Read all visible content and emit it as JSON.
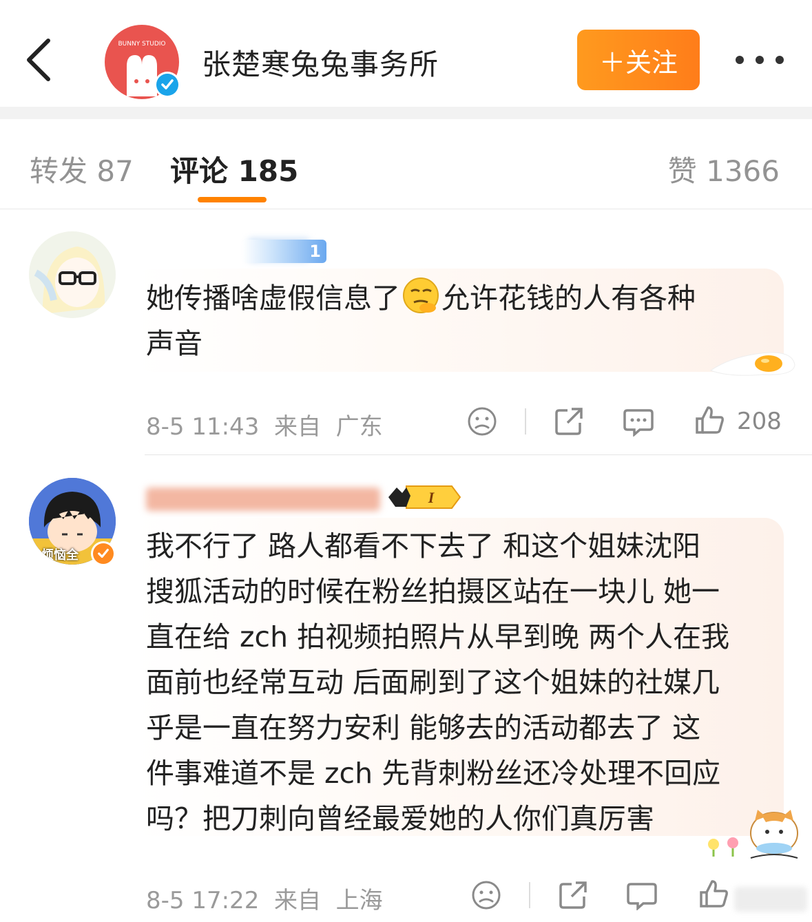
{
  "header": {
    "page_title": "张楚寒兔兔事务所",
    "avatar_text": "BUNNY STUDIO",
    "follow_label": "＋关注",
    "verified": true
  },
  "tabs": {
    "repost": "转发 87",
    "comment": "评论 185",
    "like": "赞 1366"
  },
  "comments": [
    {
      "user_badge": "1",
      "text_line1": "她传播啥虚假信息了",
      "text_line1b": "允许花钱的人有各种",
      "text_line2": "声音",
      "time": "8-5 11:43",
      "from_label": "来自",
      "location": "广东",
      "like_count": "208"
    },
    {
      "avatar_caption": "烦恼全",
      "fan_level": "I",
      "text_lines": [
        "我不行了 路人都看不下去了 和这个姐妹沈阳",
        "搜狐活动的时候在粉丝拍摄区站在一块儿 她一",
        "直在给 zch 拍视频拍照片从早到晚 两个人在我",
        "面前也经常互动 后面刷到了这个姐妹的社媒几",
        "乎是一直在努力安利 能够去的活动都去了 这",
        "件事难道不是 zch 先背刺粉丝还冷处理不回应",
        "吗？把刀刺向曾经最爱她的人你们真厉害"
      ],
      "time": "8-5 17:22",
      "from_label": "来自",
      "location": "上海"
    }
  ]
}
